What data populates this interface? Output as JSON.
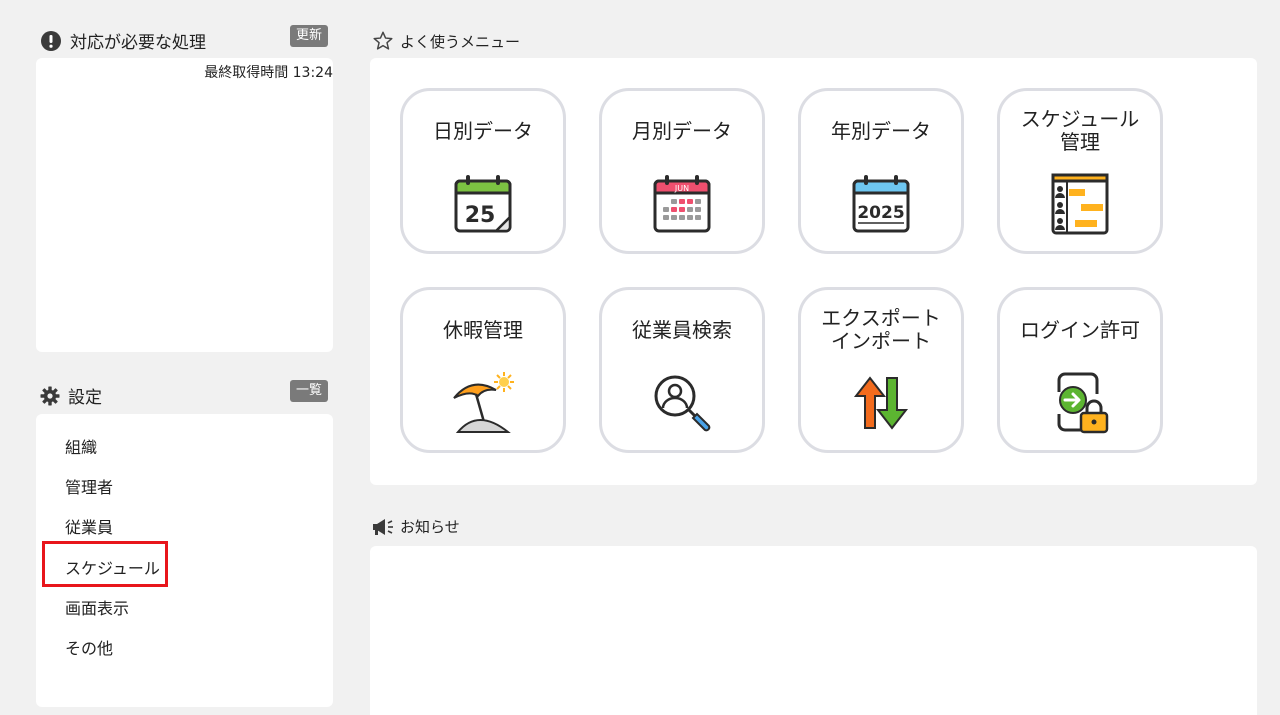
{
  "tasks": {
    "title": "対応が必要な処理",
    "refresh_label": "更新",
    "last_fetched": "最終取得時間 13:24"
  },
  "settings": {
    "title": "設定",
    "list_label": "一覧",
    "items": [
      {
        "label": "組織"
      },
      {
        "label": "管理者"
      },
      {
        "label": "従業員"
      },
      {
        "label": "スケジュール"
      },
      {
        "label": "画面表示"
      },
      {
        "label": "その他"
      }
    ]
  },
  "favorites": {
    "title": "よく使うメニュー",
    "tiles": [
      {
        "label": "日別データ",
        "icon": "calendar-day-icon",
        "icon_text": "25"
      },
      {
        "label": "月別データ",
        "icon": "calendar-month-icon",
        "icon_text": "JUN"
      },
      {
        "label": "年別データ",
        "icon": "calendar-year-icon",
        "icon_text": "2025"
      },
      {
        "label": "スケジュール\n管理",
        "icon": "schedule-chart-icon"
      },
      {
        "label": "休暇管理",
        "icon": "beach-umbrella-icon"
      },
      {
        "label": "従業員検索",
        "icon": "employee-search-icon"
      },
      {
        "label": "エクスポート\nインポート",
        "icon": "up-down-arrows-icon"
      },
      {
        "label": "ログイン許可",
        "icon": "login-lock-icon"
      }
    ]
  },
  "news": {
    "title": "お知らせ"
  },
  "colors": {
    "panel_bg": "#ffffff",
    "page_bg": "#f1f1f1",
    "highlight": "#e8151b",
    "tile_border": "#dcdde3"
  }
}
